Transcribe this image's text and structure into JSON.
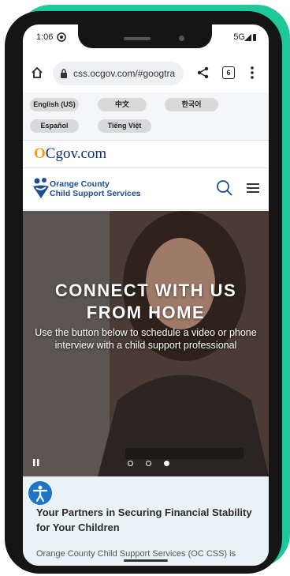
{
  "status_bar": {
    "time": "1:06",
    "signal": "5G"
  },
  "browser": {
    "url": "css.ocgov.com/#googtra",
    "tab_count": "6"
  },
  "languages": [
    "English (US)",
    "中文",
    "한국어",
    "Español",
    "Tiếng Việt"
  ],
  "ocgov_logo": "gov.com",
  "brand": {
    "line1": "Orange County",
    "line2": "Child Support Services"
  },
  "hero": {
    "title_line1": "CONNECT WITH US",
    "title_line2": "FROM HOME",
    "subtitle": "Use the button below to schedule a video or phone interview with a child support professional",
    "slide_count": 3,
    "active_slide": 3
  },
  "section": {
    "title": "Your Partners in Securing Financial Stability for Your Children",
    "body": "Orange County Child Support Services (OC CSS) is"
  },
  "colors": {
    "teal_accent": "#1fc79a",
    "brand_blue": "#1d4c8f",
    "ocgov_orange": "#f59c1a"
  }
}
